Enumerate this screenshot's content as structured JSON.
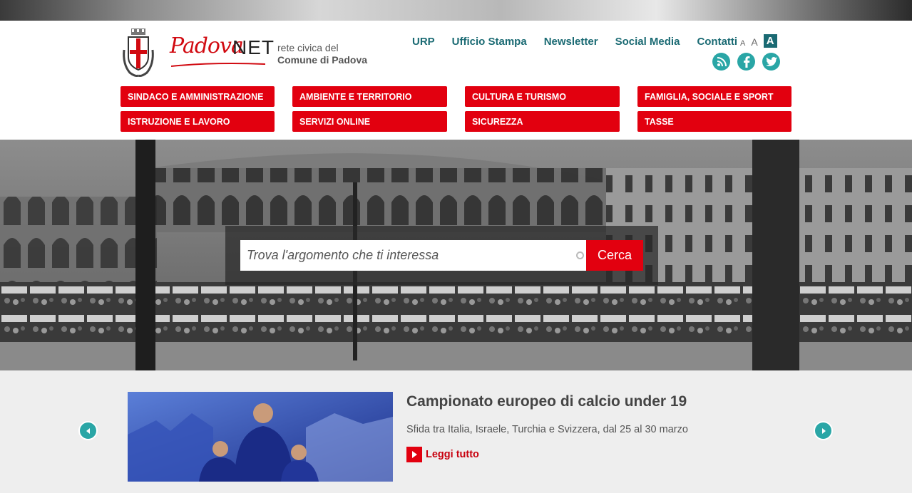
{
  "header": {
    "brand": {
      "word": "Padova",
      "suffix": "NET"
    },
    "tagline": {
      "line1": "rete civica del",
      "line2": "Comune di Padova"
    },
    "topnav": [
      "URP",
      "Ufficio Stampa",
      "Newsletter",
      "Social Media",
      "Contatti"
    ],
    "font_sizes": [
      "A",
      "A",
      "A"
    ],
    "social": [
      {
        "name": "rss-icon",
        "glyph": "))"
      },
      {
        "name": "facebook-icon",
        "glyph": "f"
      },
      {
        "name": "twitter-icon",
        "glyph": "t"
      }
    ]
  },
  "menu": [
    "SINDACO E AMMINISTRAZIONE",
    "AMBIENTE E TERRITORIO",
    "CULTURA E TURISMO",
    "FAMIGLIA, SOCIALE E SPORT",
    "ISTRUZIONE E LAVORO",
    "SERVIZI ONLINE",
    "SICUREZZA",
    "TASSE"
  ],
  "search": {
    "placeholder": "Trova l'argomento che ti interessa",
    "button": "Cerca"
  },
  "news": {
    "title": "Campionato europeo di calcio under 19",
    "subtitle": "Sfida tra Italia, Israele, Turchia e Svizzera, dal 25 al 30 marzo",
    "read_more": "Leggi tutto"
  },
  "colors": {
    "accent_red": "#e2000f",
    "teal": "#1a6a73",
    "teal_light": "#2aa6a6"
  }
}
